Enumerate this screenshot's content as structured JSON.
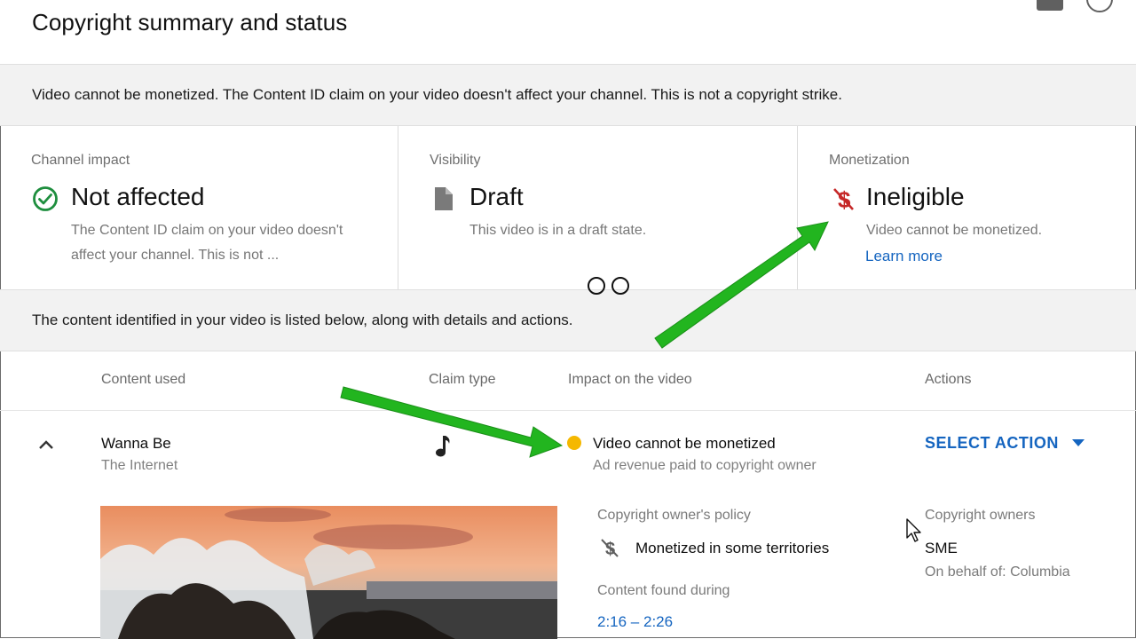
{
  "header": {
    "title": "Copyright summary and status"
  },
  "banner_top": "Video cannot be monetized. The Content ID claim on your video doesn't affect your channel. This is not a copyright strike.",
  "cards": {
    "channel": {
      "label": "Channel impact",
      "value": "Not affected",
      "desc": "The Content ID claim on your video doesn't affect your channel. This is not ...",
      "icon": "check-circle-icon",
      "color": "#1e8e3e"
    },
    "visibility": {
      "label": "Visibility",
      "value": "Draft",
      "desc": "This video is in a draft state.",
      "icon": "document-icon"
    },
    "monetization": {
      "label": "Monetization",
      "value": "Ineligible",
      "desc": "Video cannot be monetized.",
      "link": "Learn more",
      "icon": "no-dollar-icon",
      "color": "#c62828"
    }
  },
  "banner_content": "The content identified in your video is listed below, along with details and actions.",
  "table": {
    "headers": {
      "content": "Content used",
      "claim": "Claim type",
      "impact": "Impact on the video",
      "actions": "Actions"
    },
    "row": {
      "title": "Wanna Be",
      "artist": "The Internet",
      "claim_icon": "music-note-icon",
      "impact": "Video cannot be monetized",
      "impact_sub": "Ad revenue paid to copyright owner",
      "impact_color": "#f5b800",
      "action": "SELECT ACTION",
      "policy_label": "Copyright owner's policy",
      "policy": "Monetized in some territories",
      "found_label": "Content found during",
      "found_time": "2:16 – 2:26",
      "owners_label": "Copyright owners",
      "owner": "SME",
      "on_behalf": "On behalf of: Columbia"
    }
  },
  "colors": {
    "link": "#1565c0",
    "arrow": "#22b51f"
  }
}
